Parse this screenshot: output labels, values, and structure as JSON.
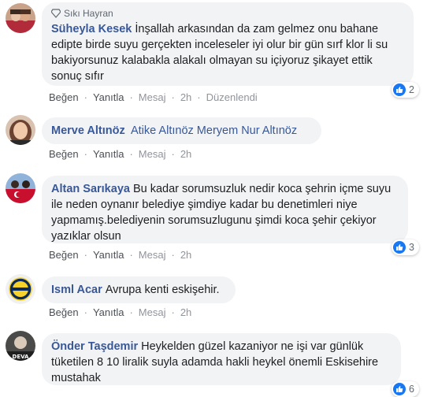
{
  "comments": [
    {
      "badge": "Sıkı Hayran",
      "name": "Süheyla Kesek",
      "text": "İnşallah arkasından da zam gelmez onu bahane edipte birde suyu gerçekten inceleseler iyi olur bir gün sırf klor li su bakiyorsunuz kalabakla alakalı olmayan su içiyoruz şikayet ettik sonuç sıfır",
      "reaction_count": "2",
      "actions": {
        "like": "Beğen",
        "reply": "Yanıtla",
        "message": "Mesaj",
        "time": "2h",
        "edited": "Düzenlendi"
      }
    },
    {
      "name": "Merve Altınöz",
      "mentions": [
        "Atike Altınöz",
        "Meryem Nur Altınöz"
      ],
      "actions": {
        "like": "Beğen",
        "reply": "Yanıtla",
        "message": "Mesaj",
        "time": "2h"
      }
    },
    {
      "name": "Altan Sarıkaya",
      "text": "Bu kadar sorumsuzluk nedir koca şehrin içme suyu ile neden oynanır belediye şimdiye kadar bu denetimleri niye yapmamış.belediyenin sorumsuzlugunu şimdi koca şehir çekiyor yazıklar olsun",
      "reaction_count": "3",
      "actions": {
        "like": "Beğen",
        "reply": "Yanıtla",
        "message": "Mesaj",
        "time": "2h"
      }
    },
    {
      "name": "Isml Acar",
      "text": "Avrupa kenti eskişehir.",
      "actions": {
        "like": "Beğen",
        "reply": "Yanıtla",
        "message": "Mesaj",
        "time": "2h"
      }
    },
    {
      "name": "Önder Taşdemir",
      "text": "Heykelden güzel kazaniyor ne işi var günlük tüketilen 8 10 liralik suyla adamda hakli heykel önemli Eskisehire mustahak",
      "reaction_count": "6",
      "avatar_text": "DEVA"
    }
  ],
  "colors": {
    "name": "#385898",
    "bubble": "#f2f3f5",
    "like": "#1877f2",
    "action": "#4b4f56"
  }
}
